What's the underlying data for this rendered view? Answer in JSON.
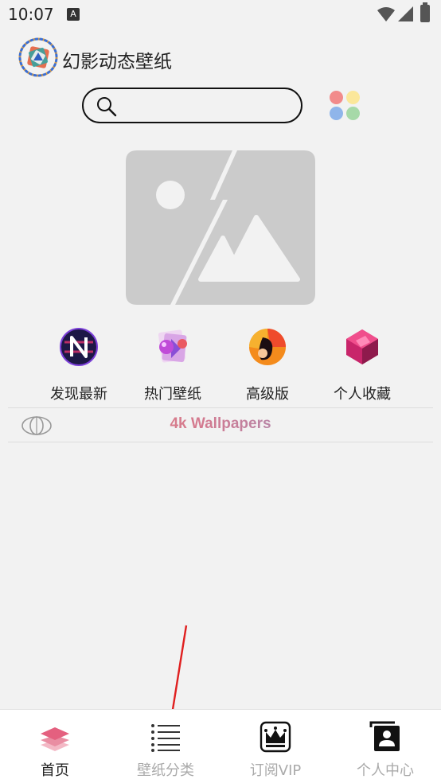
{
  "status_bar": {
    "time": "10:07",
    "notification_icon": "A"
  },
  "header": {
    "app_title": "幻影动态壁纸"
  },
  "search": {
    "placeholder": "",
    "value": ""
  },
  "colors": {
    "dot_red": "#f28b8b",
    "dot_yellow": "#fbe79a",
    "dot_blue": "#8fb5ea",
    "dot_green": "#a6d9a8",
    "accent": "#e05a5a"
  },
  "quick_menu": [
    {
      "label": "发现最新",
      "icon": "n-logo-icon"
    },
    {
      "label": "热门壁纸",
      "icon": "gem-photo-icon"
    },
    {
      "label": "高级版",
      "icon": "orange-sphere-icon"
    },
    {
      "label": "个人收藏",
      "icon": "pink-cube-icon"
    }
  ],
  "ad": {
    "text": "4k Wallpapers"
  },
  "bottom_nav": [
    {
      "label": "首页",
      "icon": "layers-icon",
      "active": true
    },
    {
      "label": "壁纸分类",
      "icon": "list-icon",
      "active": false
    },
    {
      "label": "订阅VIP",
      "icon": "crown-icon",
      "active": false
    },
    {
      "label": "个人中心",
      "icon": "profile-card-icon",
      "active": false
    }
  ]
}
